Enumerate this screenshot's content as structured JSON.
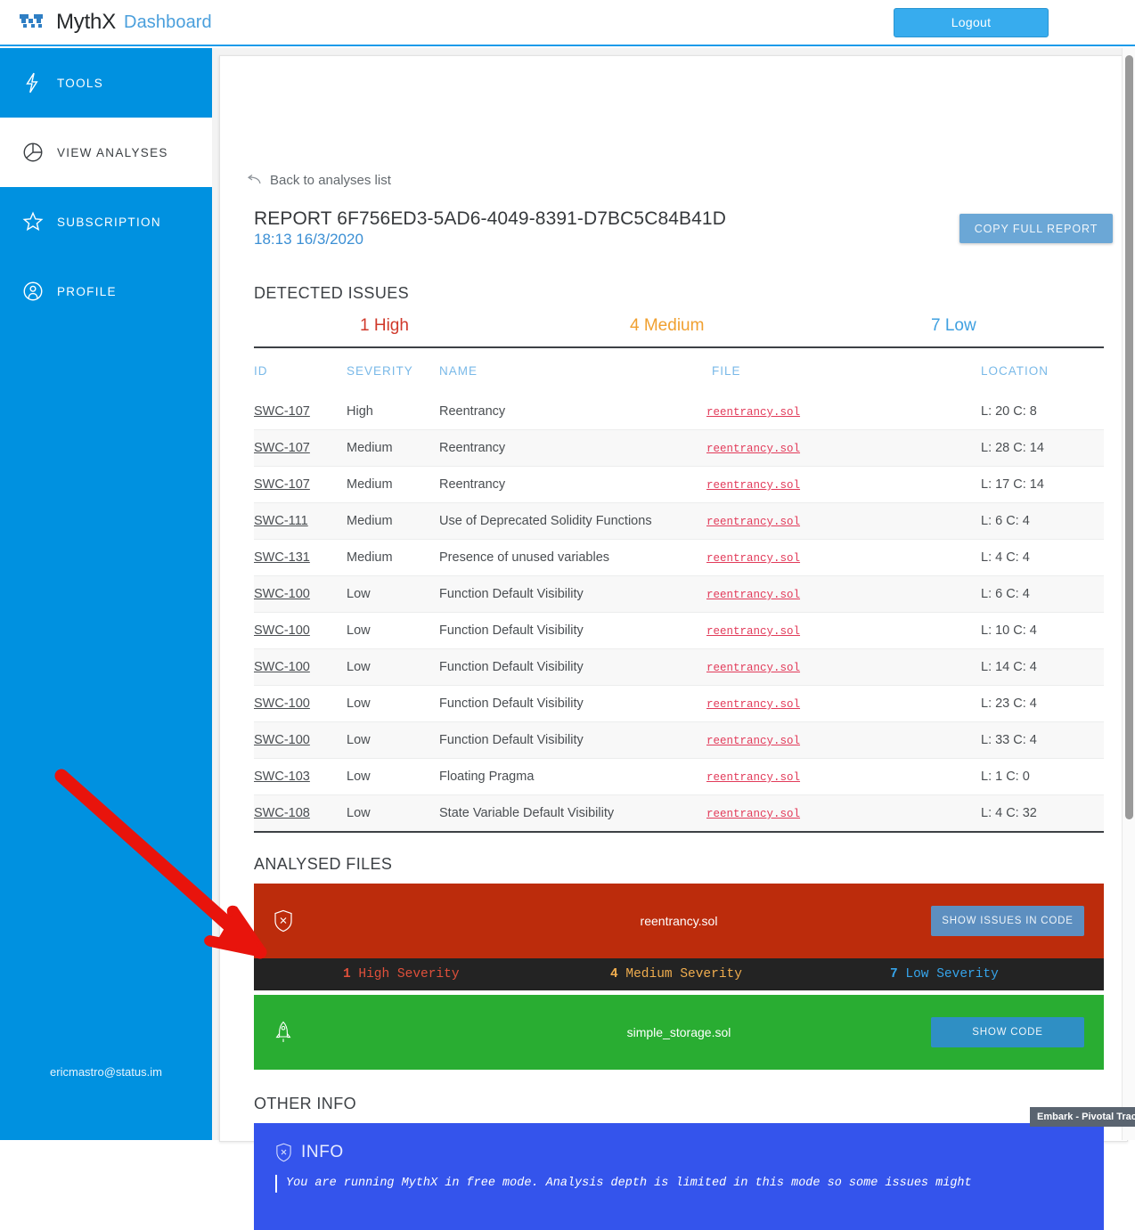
{
  "topbar": {
    "brand_name": "MythX",
    "brand_sub": "Dashboard",
    "logout_label": "Logout"
  },
  "sidebar": {
    "items": [
      {
        "label": "TOOLS",
        "icon": "bolt-icon",
        "active": false
      },
      {
        "label": "VIEW ANALYSES",
        "icon": "pie-chart-icon",
        "active": true
      },
      {
        "label": "SUBSCRIPTION",
        "icon": "star-icon",
        "active": false
      },
      {
        "label": "PROFILE",
        "icon": "user-circle-icon",
        "active": false
      }
    ],
    "email": "ericmastro@status.im"
  },
  "report": {
    "back_label": "Back to analyses list",
    "title": "REPORT 6F756ED3-5AD6-4049-8391-D7BC5C84B41D",
    "date": "18:13 16/3/2020",
    "copy_label": "COPY FULL REPORT"
  },
  "detected_issues": {
    "heading": "DETECTED ISSUES",
    "totals": {
      "high_count": "1",
      "high_label": " High",
      "medium_count": "4",
      "medium_label": " Medium",
      "low_count": "7",
      "low_label": " Low"
    },
    "columns": [
      "ID",
      "SEVERITY",
      "NAME",
      "FILE",
      "LOCATION"
    ],
    "rows": [
      {
        "id": "SWC-107",
        "severity": "High",
        "sev_class": "sev-high",
        "name": "Reentrancy",
        "file": "reentrancy.sol",
        "location": "L: 20 C: 8"
      },
      {
        "id": "SWC-107",
        "severity": "Medium",
        "sev_class": "sev-medium",
        "name": "Reentrancy",
        "file": "reentrancy.sol",
        "location": "L: 28 C: 14"
      },
      {
        "id": "SWC-107",
        "severity": "Medium",
        "sev_class": "sev-medium",
        "name": "Reentrancy",
        "file": "reentrancy.sol",
        "location": "L: 17 C: 14"
      },
      {
        "id": "SWC-111",
        "severity": "Medium",
        "sev_class": "sev-medium",
        "name": "Use of Deprecated Solidity Functions",
        "file": "reentrancy.sol",
        "location": "L: 6 C: 4"
      },
      {
        "id": "SWC-131",
        "severity": "Medium",
        "sev_class": "sev-medium",
        "name": "Presence of unused variables",
        "file": "reentrancy.sol",
        "location": "L: 4 C: 4"
      },
      {
        "id": "SWC-100",
        "severity": "Low",
        "sev_class": "sev-low",
        "name": "Function Default Visibility",
        "file": "reentrancy.sol",
        "location": "L: 6 C: 4"
      },
      {
        "id": "SWC-100",
        "severity": "Low",
        "sev_class": "sev-low",
        "name": "Function Default Visibility",
        "file": "reentrancy.sol",
        "location": "L: 10 C: 4"
      },
      {
        "id": "SWC-100",
        "severity": "Low",
        "sev_class": "sev-low",
        "name": "Function Default Visibility",
        "file": "reentrancy.sol",
        "location": "L: 14 C: 4"
      },
      {
        "id": "SWC-100",
        "severity": "Low",
        "sev_class": "sev-low",
        "name": "Function Default Visibility",
        "file": "reentrancy.sol",
        "location": "L: 23 C: 4"
      },
      {
        "id": "SWC-100",
        "severity": "Low",
        "sev_class": "sev-low",
        "name": "Function Default Visibility",
        "file": "reentrancy.sol",
        "location": "L: 33 C: 4"
      },
      {
        "id": "SWC-103",
        "severity": "Low",
        "sev_class": "sev-low",
        "name": "Floating Pragma",
        "file": "reentrancy.sol",
        "location": "L: 1 C: 0"
      },
      {
        "id": "SWC-108",
        "severity": "Low",
        "sev_class": "sev-low",
        "name": "State Variable Default Visibility",
        "file": "reentrancy.sol",
        "location": "L: 4 C: 32"
      }
    ]
  },
  "analysed_files": {
    "heading": "ANALYSED FILES",
    "red_file": {
      "name": "reentrancy.sol",
      "icon": "shield-x-icon",
      "button_label": "SHOW ISSUES IN CODE",
      "severity_bar": {
        "high_count": "1",
        "high_label": " High Severity",
        "medium_count": "4",
        "medium_label": " Medium Severity",
        "low_count": "7",
        "low_label": " Low Severity"
      }
    },
    "green_file": {
      "name": "simple_storage.sol",
      "icon": "rocket-icon",
      "button_label": "SHOW CODE"
    }
  },
  "other_info": {
    "heading": "OTHER INFO",
    "info_title": "INFO",
    "info_icon": "shield-x-icon",
    "info_text": "You are running MythX in free mode. Analysis depth is limited in this mode so some issues might"
  },
  "tooltip": {
    "label": "Embark - Pivotal Tracker"
  },
  "colors": {
    "sidebar_blue": "#0091e0",
    "accent_blue": "#37acee",
    "high_red": "#e0503b",
    "medium_orange": "#f0ad4e",
    "low_blue": "#36a4ea",
    "file_red": "#bc2c0c",
    "file_green": "#29ad32",
    "info_blue": "#3454ec",
    "annotation_red": "#e8140c"
  }
}
